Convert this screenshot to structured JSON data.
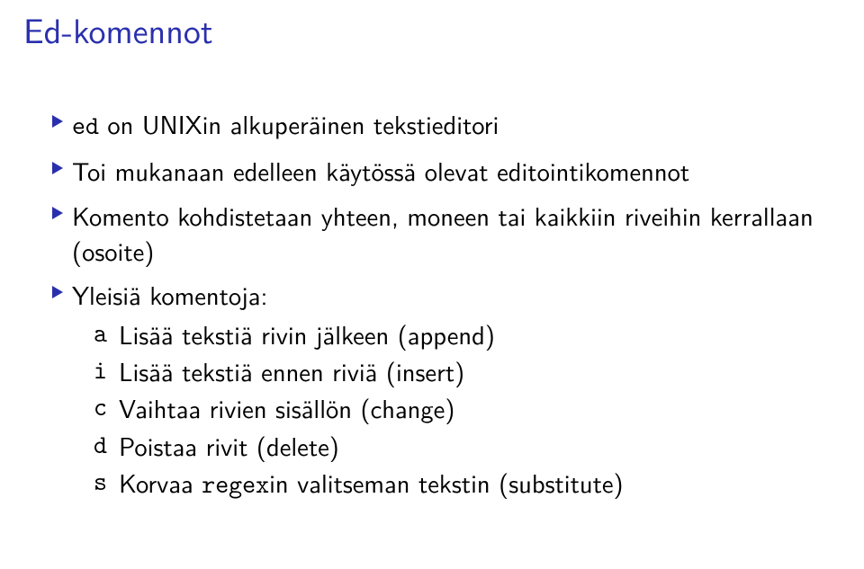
{
  "title": "Ed-komennot",
  "bullets": [
    {
      "pre": "",
      "mono": "ed",
      "post": " on UNIXin alkuperäinen tekstieditori"
    },
    {
      "pre": "Toi mukanaan edelleen käytössä olevat editointikomennot",
      "mono": "",
      "post": ""
    },
    {
      "pre": "Komento kohdistetaan yhteen, moneen tai kaikkiin riveihin kerrallaan (osoite)",
      "mono": "",
      "post": ""
    },
    {
      "pre": "Yleisiä komentoja:",
      "mono": "",
      "post": ""
    }
  ],
  "sub": [
    {
      "letter": "a",
      "text": "Lisää tekstiä rivin jälkeen (append)"
    },
    {
      "letter": "i",
      "text": "Lisää tekstiä ennen riviä (insert)"
    },
    {
      "letter": "c",
      "text": "Vaihtaa rivien sisällön (change)"
    },
    {
      "letter": "d",
      "text": "Poistaa rivit (delete)"
    },
    {
      "letter": "s",
      "text_pre": "Korvaa ",
      "text_mono": "regex",
      "text_post": "in valitseman tekstin (substitute)"
    }
  ],
  "tri_color": "#2a30ad"
}
